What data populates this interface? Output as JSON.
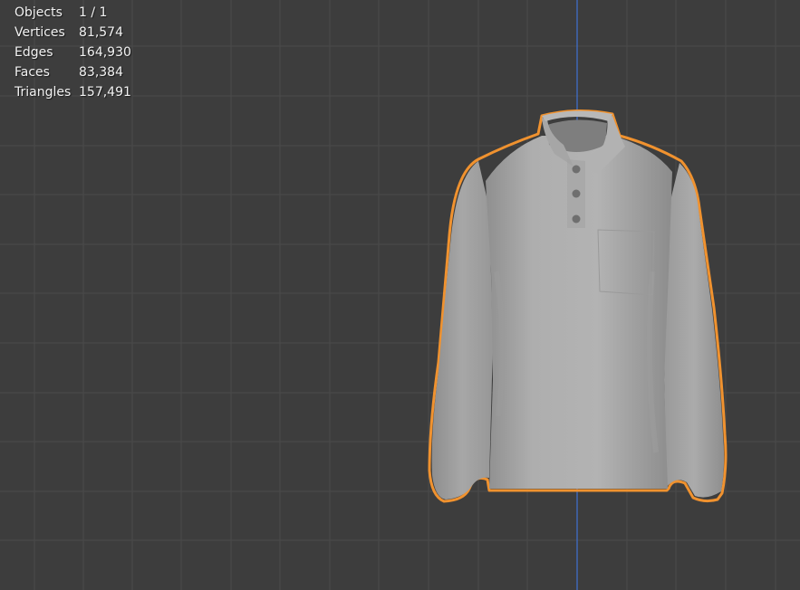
{
  "viewport": {
    "background_color": "#3d3d3d",
    "grid_color": "#4a4a4a",
    "z_axis_color": "#3f67b5",
    "selection_outline_color": "#f0922f",
    "mesh_color": "#a9a9a9"
  },
  "statistics": [
    {
      "label": "Objects",
      "value": "1 / 1"
    },
    {
      "label": "Vertices",
      "value": "81,574"
    },
    {
      "label": "Edges",
      "value": "164,930"
    },
    {
      "label": "Faces",
      "value": "83,384"
    },
    {
      "label": "Triangles",
      "value": "157,491"
    }
  ],
  "selected_object": {
    "icon": "long-sleeve-polo-shirt-mesh",
    "selected": true
  }
}
